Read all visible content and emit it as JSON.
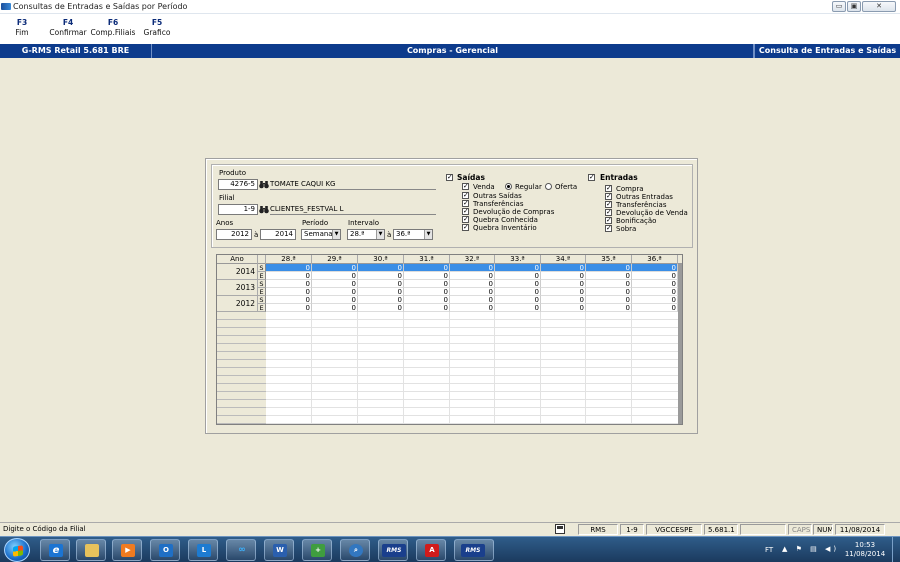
{
  "window": {
    "title": "Consultas de Entradas e Saídas por Período",
    "btn_min": "▭",
    "btn_max": "▣",
    "btn_close": "✕"
  },
  "toolbar": {
    "keys": [
      {
        "key": "F3",
        "label": "Fim"
      },
      {
        "key": "F4",
        "label": "Confirmar"
      },
      {
        "key": "F6",
        "label": "Comp.Filiais"
      },
      {
        "key": "F5",
        "label": "Grafico"
      }
    ]
  },
  "header": {
    "left": "G-RMS Retail 5.681 BRE",
    "center": "Compras - Gerencial",
    "right": "Consulta de Entradas e Saídas"
  },
  "filters": {
    "produto_label": "Produto",
    "produto_code": "4276-5",
    "produto_name": "TOMATE CAQUI KG",
    "filial_label": "Filial",
    "filial_code": "1-9",
    "filial_name": "CLIENTES_FESTVAL L",
    "anos_label": "Anos",
    "ano_from": "2012",
    "ano_sep": "à",
    "ano_to": "2014",
    "periodo_label": "Período",
    "periodo_value": "Semana",
    "intervalo_label": "Intervalo",
    "intervalo_from": "28.ª",
    "intervalo_sep": "à",
    "intervalo_to": "36.ª"
  },
  "saidas": {
    "title": "Saídas",
    "checked": true,
    "venda": "Venda",
    "regular": "Regular",
    "oferta": "Oferta",
    "items": [
      "Outras Saídas",
      "Transferências",
      "Devolução de Compras",
      "Quebra Conhecida",
      "Quebra Inventário"
    ]
  },
  "entradas": {
    "title": "Entradas",
    "checked": true,
    "items": [
      "Compra",
      "Outras Entradas",
      "Transferências",
      "Devolução de Venda",
      "Bonificação",
      "Sobra"
    ]
  },
  "grid": {
    "year_header": "Ano",
    "columns": [
      "28.ª",
      "29.ª",
      "30.ª",
      "31.ª",
      "32.ª",
      "33.ª",
      "34.ª",
      "35.ª",
      "36.ª"
    ],
    "years": [
      {
        "year": "2014",
        "S": [
          "0",
          "0",
          "0",
          "0",
          "0",
          "0",
          "0",
          "0",
          "0"
        ],
        "E": [
          "0",
          "0",
          "0",
          "0",
          "0",
          "0",
          "0",
          "0",
          "0"
        ]
      },
      {
        "year": "2013",
        "S": [
          "0",
          "0",
          "0",
          "0",
          "0",
          "0",
          "0",
          "0",
          "0"
        ],
        "E": [
          "0",
          "0",
          "0",
          "0",
          "0",
          "0",
          "0",
          "0",
          "0"
        ]
      },
      {
        "year": "2012",
        "S": [
          "0",
          "0",
          "0",
          "0",
          "0",
          "0",
          "0",
          "0",
          "0"
        ],
        "E": [
          "0",
          "0",
          "0",
          "0",
          "0",
          "0",
          "0",
          "0",
          "0"
        ]
      }
    ],
    "s_label": "S",
    "e_label": "E"
  },
  "status": {
    "hint": "Digite o Código da Filial",
    "module": "RMS",
    "filial": "1-9",
    "user": "VGCCESPE",
    "version": "5.681.1",
    "caps": "CAPS",
    "num": "NUM",
    "date": "11/08/2014"
  },
  "taskbar": {
    "apps": [
      "ie",
      "explorer",
      "media",
      "outlook",
      "lync",
      "teamviewer",
      "word",
      "installer",
      "search",
      "rms",
      "acrobat",
      "rms"
    ],
    "rms_label": "RMS",
    "tray_lang": "FT",
    "tray_icons": "▲ ⚑ ▤ ◀)",
    "time": "10:53",
    "date": "11/08/2014"
  }
}
